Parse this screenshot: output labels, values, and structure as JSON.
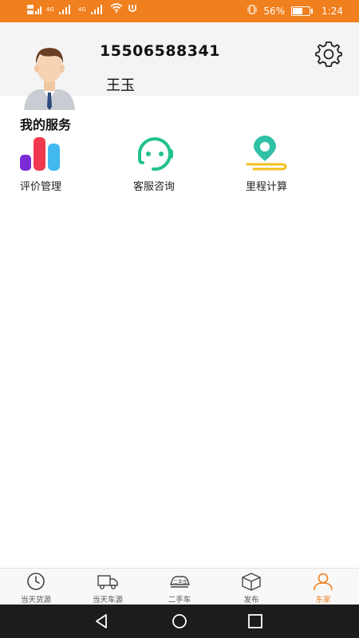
{
  "status_bar": {
    "left_icons": [
      "hd-signal-icon",
      "4g-signal-icon",
      "4g-signal-icon",
      "wifi-icon",
      "notification-icon"
    ],
    "network_labels": [
      "4G",
      "4G"
    ],
    "battery_percent": "56%",
    "battery_level": 0.56,
    "time": "1:24"
  },
  "profile": {
    "phone": "15506588341",
    "name": "王玉"
  },
  "services": {
    "title": "我的服务",
    "items": [
      {
        "label": "评价管理",
        "icon": "bar-chart-icon"
      },
      {
        "label": "客服咨询",
        "icon": "headset-chat-icon"
      },
      {
        "label": "里程计算",
        "icon": "location-pin-icon"
      }
    ]
  },
  "tabbar": {
    "tabs": [
      {
        "label": "当天货源",
        "icon": "clock-icon"
      },
      {
        "label": "当天车源",
        "icon": "truck-icon"
      },
      {
        "label": "二手车",
        "icon": "used-car-icon"
      },
      {
        "label": "发布",
        "icon": "box-icon"
      },
      {
        "label": "东家",
        "icon": "person-icon"
      }
    ],
    "active_index": 4,
    "active_color": "#f07f1e"
  },
  "colors": {
    "accent": "#f07f1e",
    "header_bg": "#f4f4f4",
    "chart_purple": "#7b2bd6",
    "chart_red": "#f0394f",
    "chart_blue": "#41b8f0",
    "chat_green": "#23c28a",
    "pin_teal": "#2fc0a6",
    "pin_yellow": "#f4c01e"
  }
}
